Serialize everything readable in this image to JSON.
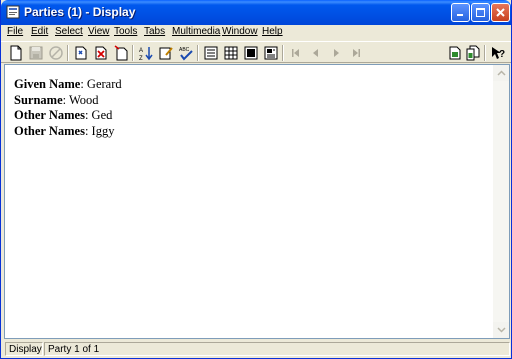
{
  "window": {
    "title": "Parties (1) - Display"
  },
  "menu": {
    "items": [
      {
        "id": "file",
        "label": "File"
      },
      {
        "id": "edit",
        "label": "Edit"
      },
      {
        "id": "select",
        "label": "Select"
      },
      {
        "id": "view",
        "label": "View"
      },
      {
        "id": "tools",
        "label": "Tools"
      },
      {
        "id": "tabs",
        "label": "Tabs"
      },
      {
        "id": "multimedia",
        "label": "Multimedia"
      },
      {
        "id": "window",
        "label": "Window"
      },
      {
        "id": "help",
        "label": "Help"
      }
    ]
  },
  "toolbar": {
    "icons": [
      "new-document-icon",
      "save-icon",
      "cancel-icon",
      "new-record-icon",
      "delete-record-icon",
      "copy-record-icon",
      "sort-icon",
      "edit-icon",
      "spell-check-icon",
      "display-view-icon",
      "table-view-icon",
      "form-view-icon",
      "report-view-icon",
      "first-record-icon",
      "previous-record-icon",
      "next-record-icon",
      "last-record-icon",
      "report-icon",
      "report-copy-icon",
      "context-help-icon"
    ]
  },
  "record": {
    "fields": [
      {
        "label": "Given Name",
        "value": "Gerard"
      },
      {
        "label": "Surname",
        "value": "Wood"
      },
      {
        "label": "Other Names",
        "value": "Ged"
      },
      {
        "label": "Other Names",
        "value": "Iggy"
      }
    ],
    "separator": ": "
  },
  "status": {
    "mode": "Display",
    "position": "Party 1 of 1"
  },
  "colors": {
    "title_bar": "#0050e4",
    "face": "#ece9d8",
    "content_bg": "#ffffff"
  }
}
